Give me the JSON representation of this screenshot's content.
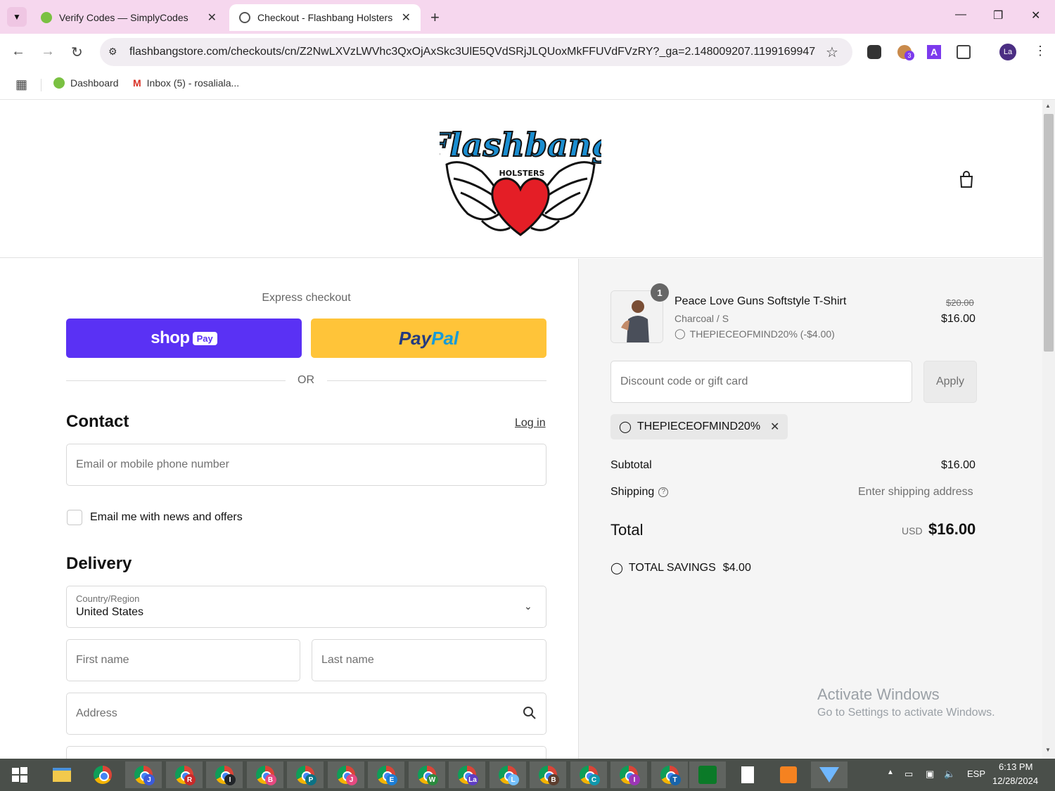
{
  "browser": {
    "tabs": [
      {
        "title": "Verify Codes — SimplyCodes",
        "active": false
      },
      {
        "title": "Checkout - Flashbang Holsters",
        "active": true
      }
    ],
    "url": "flashbangstore.com/checkouts/cn/Z2NwLXVzLWVhc3QxOjAxSkc3UlE5QVdSRjJLQUoxMkFFUVdFVzRY?_ga=2.148009207.1199169947....",
    "extension_badge": "3",
    "profile_initials": "La",
    "bookmarks": [
      {
        "label": "Dashboard",
        "icon": "simplycodes-icon"
      },
      {
        "label": "Inbox (5) - rosaliala...",
        "icon": "gmail-icon"
      }
    ]
  },
  "store": {
    "logo_text": "Flashbang",
    "logo_subtext": "HOLSTERS"
  },
  "checkout": {
    "express_title": "Express checkout",
    "shoppay_word": "shop",
    "shoppay_pill": "Pay",
    "paypal_a": "Pay",
    "paypal_b": "Pal",
    "or_text": "OR",
    "contact_title": "Contact",
    "login_label": "Log in",
    "email_placeholder": "Email or mobile phone number",
    "newsletter_label": "Email me with news and offers",
    "delivery_title": "Delivery",
    "country_label": "Country/Region",
    "country_value": "United States",
    "first_name_placeholder": "First name",
    "last_name_placeholder": "Last name",
    "address_placeholder": "Address"
  },
  "summary": {
    "item": {
      "quantity": "1",
      "name": "Peace Love Guns Softstyle T-Shirt",
      "variant": "Charcoal / S",
      "discount_line": "THEPIECEOFMIND20% (-$4.00)",
      "original_price": "$20.00",
      "price": "$16.00"
    },
    "discount_placeholder": "Discount code or gift card",
    "apply_label": "Apply",
    "applied_code": "THEPIECEOFMIND20%",
    "subtotal_label": "Subtotal",
    "subtotal_value": "$16.00",
    "shipping_label": "Shipping",
    "shipping_value": "Enter shipping address",
    "total_label": "Total",
    "currency": "USD",
    "total_value": "$16.00",
    "savings_label": "TOTAL SAVINGS",
    "savings_value": "$4.00"
  },
  "watermark": {
    "line1": "Activate Windows",
    "line2": "Go to Settings to activate Windows."
  },
  "taskbar": {
    "chrome_badges": [
      "J",
      "R",
      "I",
      "B",
      "P",
      "J",
      "E",
      "W",
      "La",
      "L",
      "B",
      "C",
      "I",
      "T"
    ],
    "language": "ESP",
    "time": "6:13 PM",
    "date": "12/28/2024"
  },
  "colors": {
    "shoppay": "#5a31f4",
    "paypal": "#ffc439",
    "tabbar": "#f6d7ee"
  }
}
